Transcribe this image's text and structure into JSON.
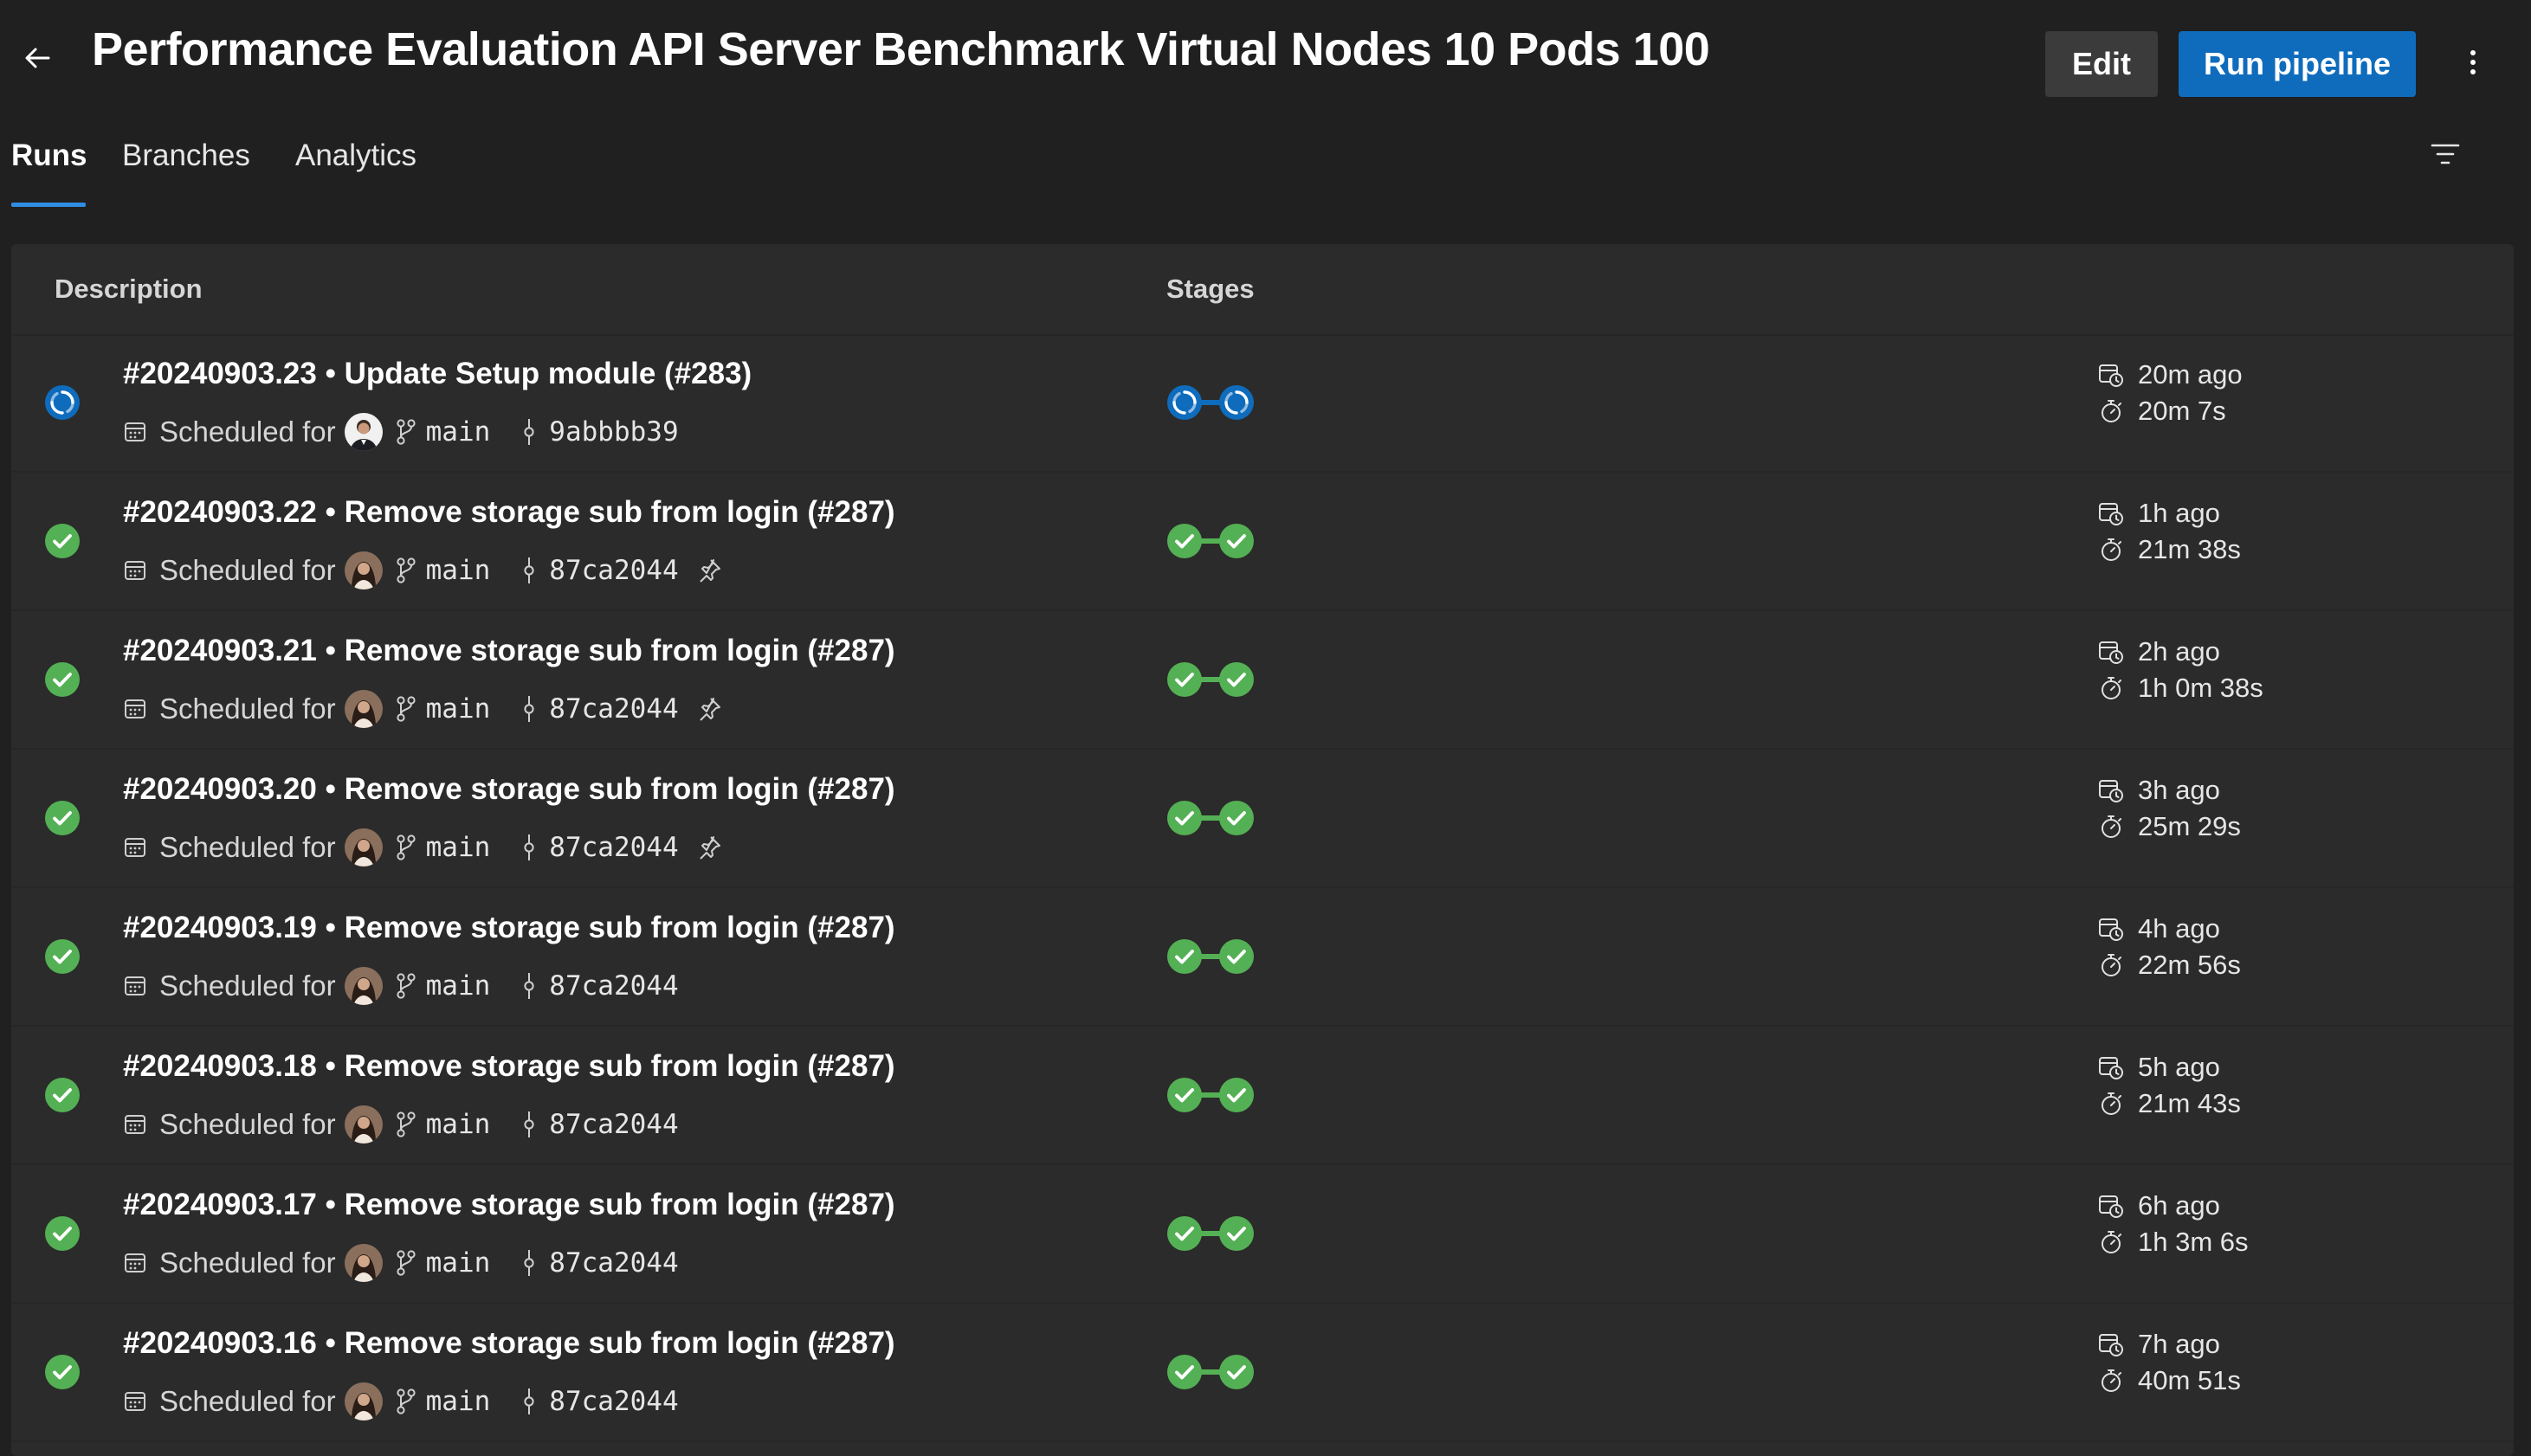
{
  "header": {
    "title": "Performance Evaluation API Server Benchmark Virtual Nodes 10 Pods 100",
    "edit_label": "Edit",
    "run_label": "Run pipeline",
    "back_icon": "arrow-left-icon",
    "more_icon": "more-vertical-icon"
  },
  "tabs": [
    {
      "label": "Runs",
      "active": true
    },
    {
      "label": "Branches",
      "active": false
    },
    {
      "label": "Analytics",
      "active": false
    }
  ],
  "filter_icon": "filter-icon",
  "table": {
    "columns": {
      "description": "Description",
      "stages": "Stages"
    },
    "rows": [
      {
        "id": "#20240903.23",
        "sep": "•",
        "message": "Update Setup module (#283)",
        "trigger": "Scheduled for",
        "branch": "main",
        "commit": "9abbbb39",
        "pinned": false,
        "status": "running",
        "stages": [
          "running",
          "running"
        ],
        "ago": "20m ago",
        "duration": "20m 7s"
      },
      {
        "id": "#20240903.22",
        "sep": "•",
        "message": "Remove storage sub from login (#287)",
        "trigger": "Scheduled for",
        "branch": "main",
        "commit": "87ca2044",
        "pinned": true,
        "status": "succeeded",
        "stages": [
          "succeeded",
          "succeeded"
        ],
        "ago": "1h ago",
        "duration": "21m 38s"
      },
      {
        "id": "#20240903.21",
        "sep": "•",
        "message": "Remove storage sub from login (#287)",
        "trigger": "Scheduled for",
        "branch": "main",
        "commit": "87ca2044",
        "pinned": true,
        "status": "succeeded",
        "stages": [
          "succeeded",
          "succeeded"
        ],
        "ago": "2h ago",
        "duration": "1h 0m 38s"
      },
      {
        "id": "#20240903.20",
        "sep": "•",
        "message": "Remove storage sub from login (#287)",
        "trigger": "Scheduled for",
        "branch": "main",
        "commit": "87ca2044",
        "pinned": true,
        "status": "succeeded",
        "stages": [
          "succeeded",
          "succeeded"
        ],
        "ago": "3h ago",
        "duration": "25m 29s"
      },
      {
        "id": "#20240903.19",
        "sep": "•",
        "message": "Remove storage sub from login (#287)",
        "trigger": "Scheduled for",
        "branch": "main",
        "commit": "87ca2044",
        "pinned": false,
        "status": "succeeded",
        "stages": [
          "succeeded",
          "succeeded"
        ],
        "ago": "4h ago",
        "duration": "22m 56s"
      },
      {
        "id": "#20240903.18",
        "sep": "•",
        "message": "Remove storage sub from login (#287)",
        "trigger": "Scheduled for",
        "branch": "main",
        "commit": "87ca2044",
        "pinned": false,
        "status": "succeeded",
        "stages": [
          "succeeded",
          "succeeded"
        ],
        "ago": "5h ago",
        "duration": "21m 43s"
      },
      {
        "id": "#20240903.17",
        "sep": "•",
        "message": "Remove storage sub from login (#287)",
        "trigger": "Scheduled for",
        "branch": "main",
        "commit": "87ca2044",
        "pinned": false,
        "status": "succeeded",
        "stages": [
          "succeeded",
          "succeeded"
        ],
        "ago": "6h ago",
        "duration": "1h 3m 6s"
      },
      {
        "id": "#20240903.16",
        "sep": "•",
        "message": "Remove storage sub from login (#287)",
        "trigger": "Scheduled for",
        "branch": "main",
        "commit": "87ca2044",
        "pinned": false,
        "status": "succeeded",
        "stages": [
          "succeeded",
          "succeeded"
        ],
        "ago": "7h ago",
        "duration": "40m 51s"
      }
    ]
  },
  "colors": {
    "accent": "#0f6cbd",
    "success": "#54b054",
    "running": "#0f6cbd",
    "background": "#202020",
    "panel": "#2b2b2b"
  }
}
